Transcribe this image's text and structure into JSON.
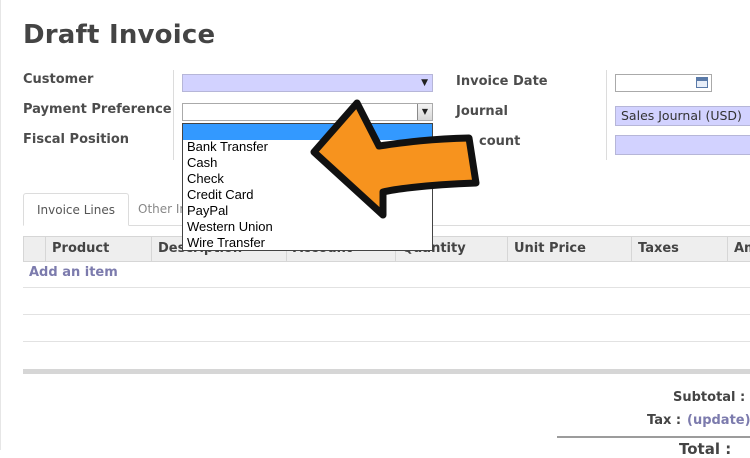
{
  "page": {
    "title": "Draft Invoice"
  },
  "form": {
    "customer_label": "Customer",
    "payment_preference_label": "Payment Preference",
    "fiscal_position_label": "Fiscal Position",
    "invoice_date_label": "Invoice Date",
    "journal_label": "Journal",
    "account_label_visible": "count",
    "journal_value": "Sales Journal (USD)",
    "customer_value": "",
    "payment_preference_value": "",
    "invoice_date_value": "",
    "account_value": ""
  },
  "dropdown": {
    "options": [
      "",
      "Bank Transfer",
      "Cash",
      "Check",
      "Credit Card",
      "PayPal",
      "Western Union",
      "Wire Transfer"
    ],
    "selected_index": 0
  },
  "tabs": [
    {
      "label": "Invoice Lines",
      "active": true
    },
    {
      "label": "Other In",
      "active": false
    }
  ],
  "table": {
    "headers": [
      "Product",
      "Description",
      "Account",
      "Quantity",
      "Unit Price",
      "Taxes",
      "Am"
    ],
    "add_item_label": "Add an item"
  },
  "summary": {
    "subtotal_label": "Subtotal :",
    "tax_label": "Tax :",
    "update_link": "(update)",
    "total_label": "Total :"
  },
  "colors": {
    "required_field": "#d2d2ff",
    "link": "#7c7bad",
    "arrow_fill": "#f7931e",
    "selected_option": "#3399ff"
  },
  "icons": {
    "calendar": "calendar-icon",
    "dropdown": "chevron-down-icon",
    "pointer_arrow": "curved-arrow-icon"
  }
}
